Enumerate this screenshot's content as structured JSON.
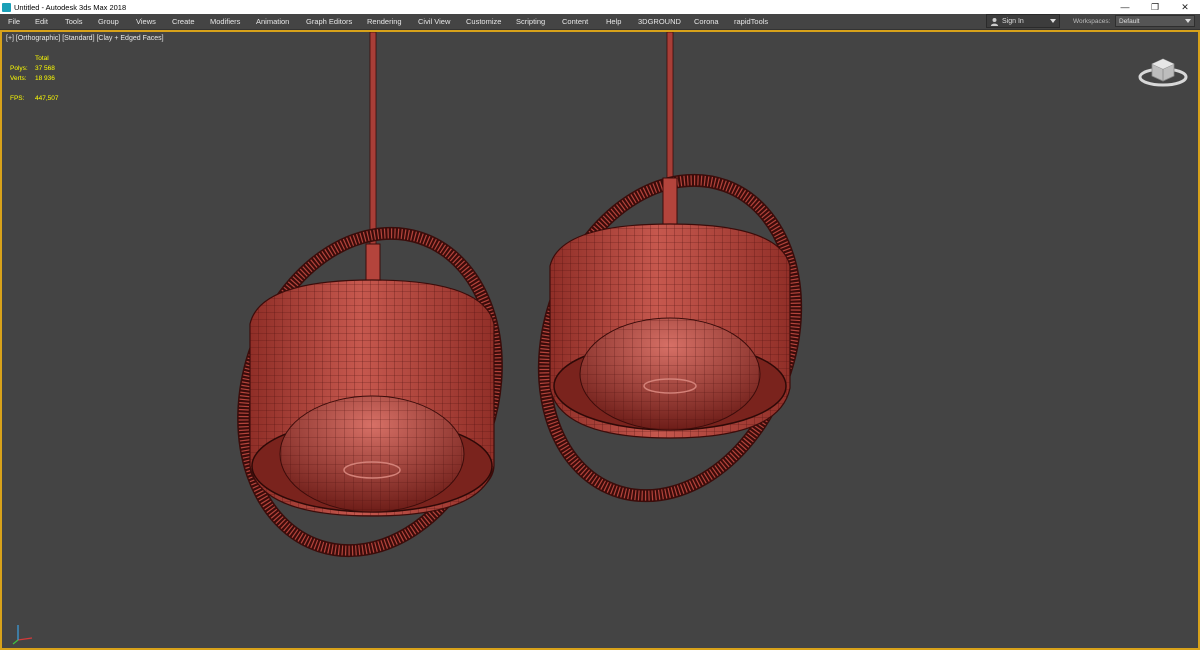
{
  "window": {
    "title": "Untitled - Autodesk 3ds Max 2018",
    "controls": [
      "—",
      "❐",
      "✕"
    ]
  },
  "menu": [
    "File",
    "Edit",
    "Tools",
    "Group",
    "Views",
    "Create",
    "Modifiers",
    "Animation",
    "Graph Editors",
    "Rendering",
    "Civil View",
    "Customize",
    "Scripting",
    "Content",
    "Help",
    "3DGROUND",
    "Corona",
    "rapidTools"
  ],
  "toolbar": {
    "signin_label": "Sign In",
    "workspaces_label": "Workspaces:",
    "workspace_value": "Default"
  },
  "viewport": {
    "label": "[+] [Orthographic] [Standard] [Clay + Edged Faces]",
    "stats": {
      "total_label": "Total",
      "polys_label": "Polys:",
      "polys_value": "37 568",
      "verts_label": "Verts:",
      "verts_value": "18 936",
      "fps_label": "FPS:",
      "fps_value": "447,507"
    }
  },
  "colors": {
    "viewport_border": "#d8a21a",
    "model_clay": "#b8463d",
    "stats_text": "#ffff00",
    "background": "#444444"
  },
  "icons": [
    "app-icon",
    "user-icon",
    "chevron-down-icon",
    "viewcube-icon",
    "axis-tripod-icon"
  ]
}
